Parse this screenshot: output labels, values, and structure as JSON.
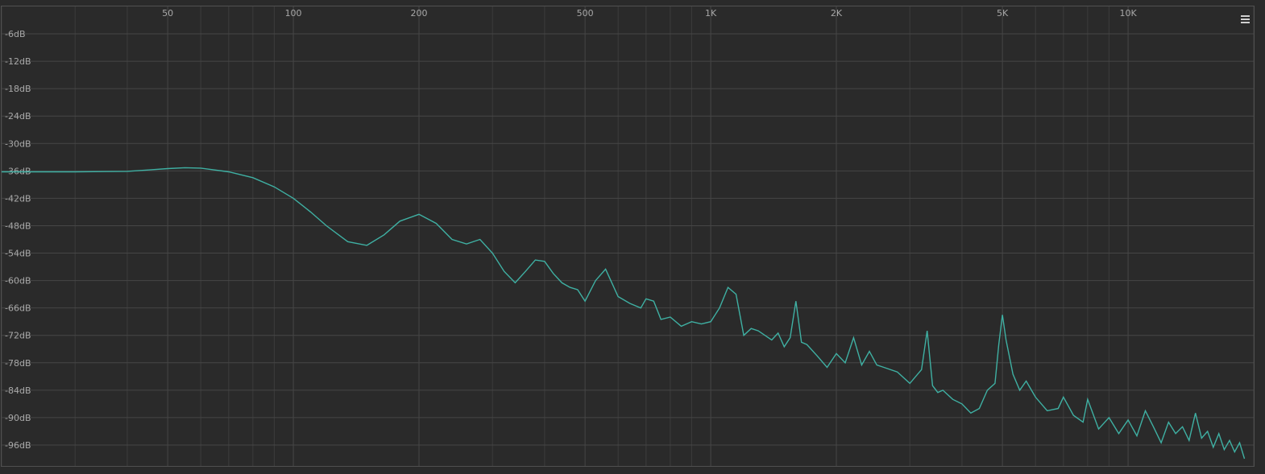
{
  "colors": {
    "background": "#2a2a2a",
    "grid": "#3c3c3c",
    "grid_major": "#464646",
    "trace": "#3fb0a3",
    "label": "#a8a8a8"
  },
  "menu": {
    "icon": "hamburger-menu-icon"
  },
  "chart_data": {
    "type": "line",
    "title": "",
    "xlabel": "",
    "ylabel": "",
    "x_scale": "log",
    "xlim": [
      20,
      20000
    ],
    "ylim": [
      -100,
      -1
    ],
    "grid": true,
    "x_ticks": [
      {
        "value": 50,
        "label": "50"
      },
      {
        "value": 100,
        "label": "100"
      },
      {
        "value": 200,
        "label": "200"
      },
      {
        "value": 500,
        "label": "500"
      },
      {
        "value": 1000,
        "label": "1K"
      },
      {
        "value": 2000,
        "label": "2K"
      },
      {
        "value": 5000,
        "label": "5K"
      },
      {
        "value": 10000,
        "label": "10K"
      }
    ],
    "y_ticks": [
      {
        "value": -6,
        "label": "-6dB"
      },
      {
        "value": -12,
        "label": "-12dB"
      },
      {
        "value": -18,
        "label": "-18dB"
      },
      {
        "value": -24,
        "label": "-24dB"
      },
      {
        "value": -30,
        "label": "-30dB"
      },
      {
        "value": -36,
        "label": "-36dB"
      },
      {
        "value": -42,
        "label": "-42dB"
      },
      {
        "value": -48,
        "label": "-48dB"
      },
      {
        "value": -54,
        "label": "-54dB"
      },
      {
        "value": -60,
        "label": "-60dB"
      },
      {
        "value": -66,
        "label": "-66dB"
      },
      {
        "value": -72,
        "label": "-72dB"
      },
      {
        "value": -78,
        "label": "-78dB"
      },
      {
        "value": -84,
        "label": "-84dB"
      },
      {
        "value": -90,
        "label": "-90dB"
      },
      {
        "value": -96,
        "label": "-96dB"
      }
    ],
    "series": [
      {
        "x": [
          20,
          30,
          40,
          45,
          50,
          55,
          60,
          70,
          80,
          90,
          100,
          110,
          120,
          135,
          150,
          165,
          180,
          200,
          220,
          240,
          260,
          280,
          300,
          320,
          340,
          360,
          380,
          400,
          420,
          440,
          460,
          480,
          500,
          530,
          560,
          600,
          640,
          680,
          700,
          730,
          760,
          800,
          850,
          900,
          950,
          1000,
          1050,
          1100,
          1150,
          1200,
          1250,
          1300,
          1400,
          1450,
          1500,
          1550,
          1600,
          1650,
          1700,
          1800,
          1900,
          2000,
          2100,
          2200,
          2300,
          2400,
          2500,
          2600,
          2800,
          3000,
          3200,
          3300,
          3400,
          3500,
          3600,
          3800,
          4000,
          4200,
          4400,
          4600,
          4800,
          4900,
          5000,
          5100,
          5300,
          5500,
          5700,
          6000,
          6400,
          6800,
          7000,
          7400,
          7800,
          8000,
          8500,
          9000,
          9500,
          10000,
          10500,
          11000,
          11500,
          12000,
          12500,
          13000,
          13500,
          14000,
          14500,
          15000,
          15500,
          16000,
          16500,
          17000,
          17500,
          18000,
          18500,
          19000
        ],
        "y": [
          -36.2,
          -36.2,
          -36.1,
          -35.8,
          -35.5,
          -35.3,
          -35.4,
          -36.2,
          -37.5,
          -39.5,
          -42.0,
          -45.0,
          -48.0,
          -51.5,
          -52.3,
          -50.0,
          -47.0,
          -45.5,
          -47.5,
          -51.0,
          -52.0,
          -51.0,
          -54.0,
          -58.0,
          -60.5,
          -58.0,
          -55.5,
          -55.8,
          -58.5,
          -60.5,
          -61.5,
          -62.0,
          -64.5,
          -60.0,
          -57.5,
          -63.5,
          -65.0,
          -66.0,
          -64.0,
          -64.5,
          -68.5,
          -68.0,
          -70.0,
          -69.0,
          -69.5,
          -69.0,
          -66.0,
          -61.5,
          -63.0,
          -72.0,
          -70.5,
          -71.0,
          -73.0,
          -71.5,
          -74.5,
          -72.5,
          -64.5,
          -73.5,
          -74.0,
          -76.5,
          -79.0,
          -76.0,
          -78.0,
          -72.5,
          -78.5,
          -75.5,
          -78.5,
          -79.0,
          -80.0,
          -82.5,
          -79.5,
          -71.0,
          -83.0,
          -84.5,
          -84.0,
          -86.0,
          -87.0,
          -89.0,
          -88.0,
          -84.0,
          -82.5,
          -74.0,
          -67.5,
          -73.0,
          -80.5,
          -84.0,
          -82.0,
          -85.5,
          -88.5,
          -88.0,
          -85.5,
          -89.5,
          -91.0,
          -86.0,
          -92.5,
          -90.0,
          -93.5,
          -90.5,
          -94.0,
          -88.5,
          -92.0,
          -95.5,
          -91.0,
          -93.5,
          -92.0,
          -95.0,
          -89.0,
          -94.5,
          -93.0,
          -96.5,
          -93.5,
          -97.0,
          -95.0,
          -97.5,
          -95.5,
          -99.0
        ]
      }
    ]
  }
}
